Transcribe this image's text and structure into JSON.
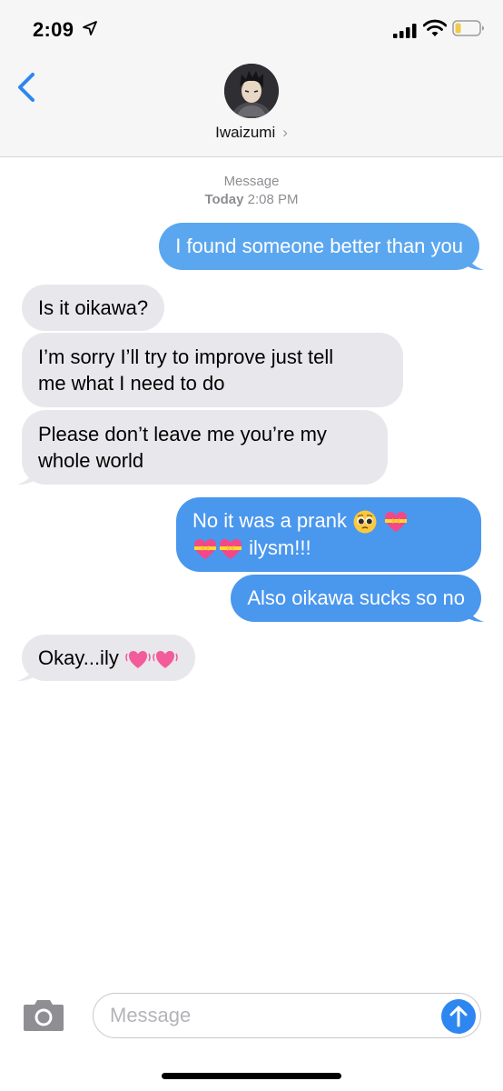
{
  "status_bar": {
    "time": "2:09",
    "battery_color": "#f2c94c"
  },
  "header": {
    "contact_name": "Iwaizumi",
    "chevron": "›"
  },
  "thread_meta": {
    "service": "Message",
    "day": "Today",
    "time": "2:08 PM"
  },
  "messages": [
    {
      "direction": "outgoing",
      "lines": [
        "I found someone better than you"
      ]
    },
    {
      "direction": "incoming",
      "lines": [
        "Is it oikawa?"
      ]
    },
    {
      "direction": "incoming",
      "lines": [
        "I’m sorry I’ll try to improve just tell",
        "me what I need to do"
      ]
    },
    {
      "direction": "incoming",
      "lines": [
        "Please don’t leave me you’re my",
        "whole world"
      ]
    },
    {
      "direction": "outgoing",
      "lines": [
        "No it was a prank",
        "ilysm!!!"
      ],
      "emojis": [
        "pleading-face",
        "heart-with-ribbon",
        "heart-with-ribbon",
        "heart-with-ribbon"
      ]
    },
    {
      "direction": "outgoing",
      "lines": [
        "Also oikawa sucks so no"
      ]
    },
    {
      "direction": "incoming",
      "lines": [
        "Okay...ily"
      ],
      "emojis": [
        "vibrating-heart",
        "vibrating-heart"
      ]
    }
  ],
  "composer": {
    "placeholder": "Message"
  },
  "colors": {
    "outgoing_bubble": "#4a97ee",
    "incoming_bubble": "#e8e8ec",
    "accent": "#2e86f0"
  }
}
